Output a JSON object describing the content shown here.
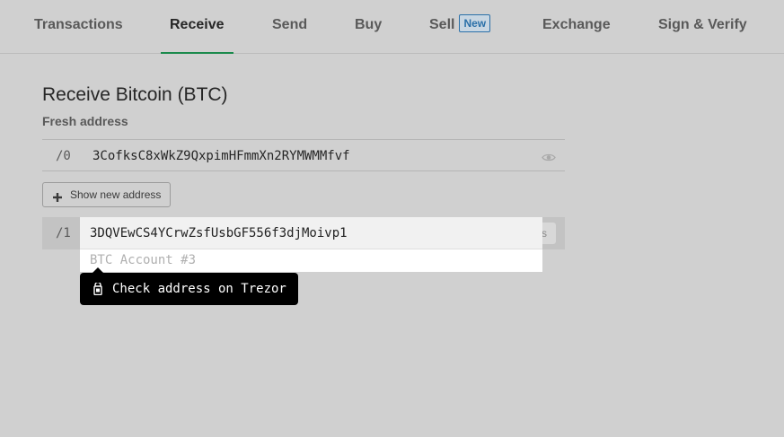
{
  "tabs": {
    "items": [
      {
        "label": "Transactions"
      },
      {
        "label": "Receive"
      },
      {
        "label": "Send"
      },
      {
        "label": "Buy"
      },
      {
        "label": "Sell",
        "badge": "New"
      },
      {
        "label": "Exchange"
      },
      {
        "label": "Sign & Verify"
      }
    ],
    "active": "Receive"
  },
  "page": {
    "title": "Receive Bitcoin (BTC)",
    "subtitle": "Fresh address"
  },
  "addresses": [
    {
      "index": "/0",
      "value": "3CofksC8xWkZ9QxpimHFmmXn2RYMWMMfvf",
      "icon": "eye-icon"
    },
    {
      "index": "/1",
      "action_fragment": "s"
    }
  ],
  "show_new_address": {
    "label": "Show new address",
    "icon": "plus-icon"
  },
  "popup": {
    "address": "3DQVEwCS4YCrwZsfUsbGF556f3djMoivp1",
    "account": "BTC Account #3"
  },
  "tooltip": {
    "text": "Check address on Trezor",
    "icon": "trezor-device-icon"
  },
  "colors": {
    "background": "#d0d0d0",
    "active_tab_underline": "#1b8a4c",
    "badge": "#2b70a8",
    "tooltip_background": "#000000"
  }
}
